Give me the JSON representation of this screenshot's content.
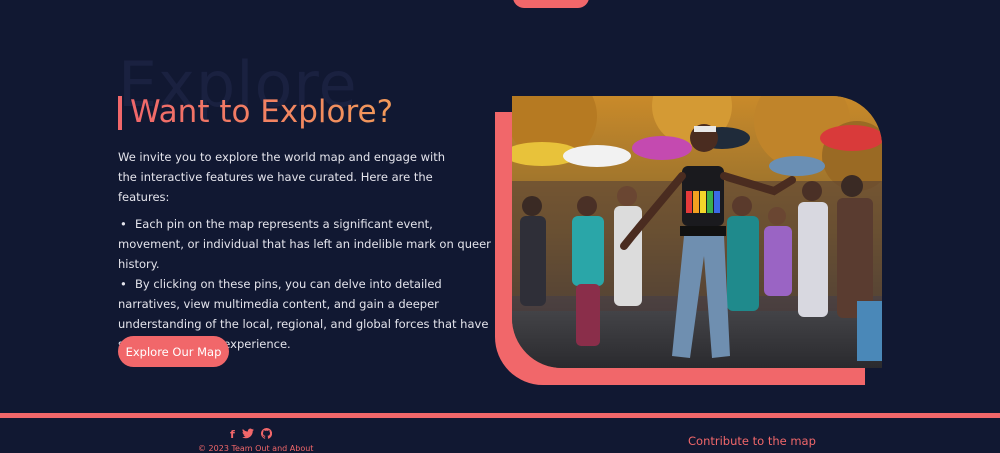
{
  "section": {
    "background_word": "Explore",
    "heading": "Want to Explore?",
    "intro": "We invite you to explore the world map and engage with the interactive features we have curated. Here are the features:",
    "features": [
      {
        "bullet": "•",
        "text": "Each pin on the map represents a significant event, movement, or individual that has left an indelible mark on queer history."
      },
      {
        "bullet": "•",
        "text": "By clicking on these pins, you can delve into detailed narratives, view multimedia content, and gain a deeper understanding of the local, regional, and global forces that have shaped the queer experience."
      }
    ],
    "cta_label": "Explore Our Map"
  },
  "footer": {
    "icons": [
      "facebook-icon",
      "twitter-icon",
      "github-icon"
    ],
    "copyright": "© 2023 Team Out and About",
    "contribute_label": "Contribute to the map"
  },
  "colors": {
    "background": "#111832",
    "accent": "#f1676a",
    "accent_gradient_end": "#f29a5a"
  }
}
